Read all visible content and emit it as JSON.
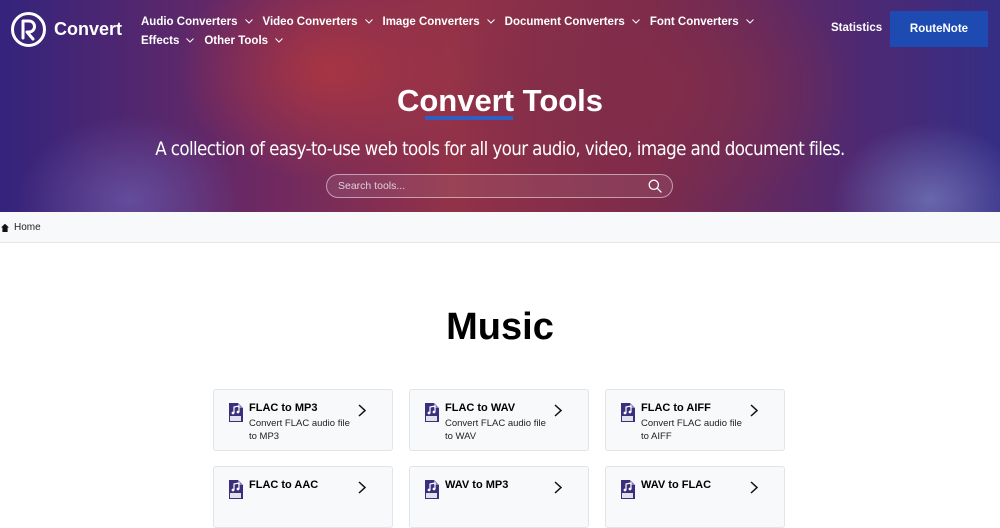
{
  "brand": {
    "name": "Convert"
  },
  "nav": {
    "row1": [
      "Audio Converters",
      "Video Converters",
      "Image Converters",
      "Document Converters",
      "Font Converters"
    ],
    "row2": [
      "Effects",
      "Other Tools"
    ],
    "statistics": "Statistics",
    "routenote": "RouteNote"
  },
  "hero": {
    "title": "Convert Tools",
    "subtitle": "A collection of easy-to-use web tools for all your audio, video, image and document files.",
    "search_placeholder": "Search tools..."
  },
  "breadcrumb": {
    "home": "Home"
  },
  "section": {
    "title": "Music"
  },
  "cards": [
    {
      "title": "FLAC to MP3",
      "desc": "Convert FLAC audio file to MP3"
    },
    {
      "title": "FLAC to WAV",
      "desc": "Convert FLAC audio file to WAV"
    },
    {
      "title": "FLAC to AIFF",
      "desc": "Convert FLAC audio file to AIFF"
    },
    {
      "title": "FLAC to AAC",
      "desc": ""
    },
    {
      "title": "WAV to MP3",
      "desc": ""
    },
    {
      "title": "WAV to FLAC",
      "desc": ""
    }
  ],
  "colors": {
    "accent": "#1d4bb2",
    "icon": "#3b2e7a"
  },
  "icons": {
    "file": "music-file-icon",
    "chevron": "chevron-right-icon"
  }
}
